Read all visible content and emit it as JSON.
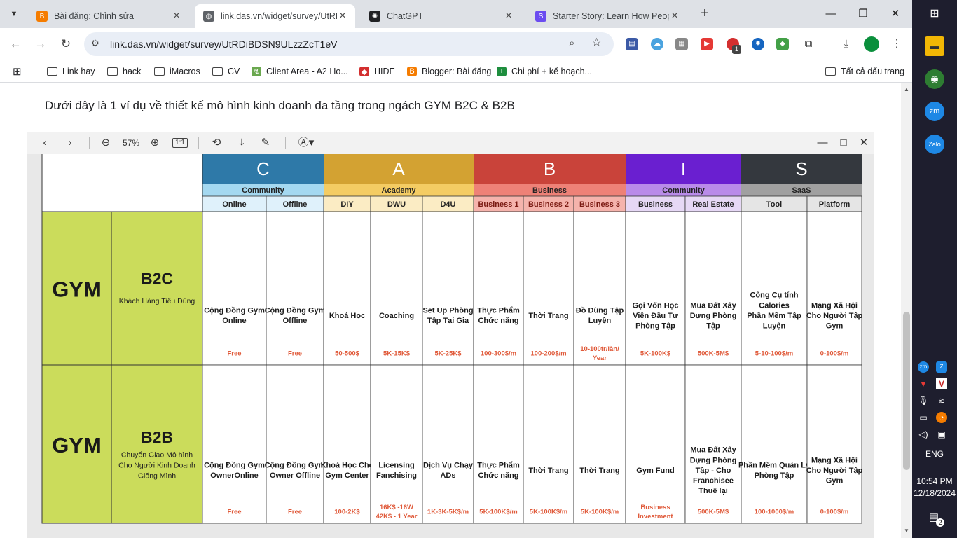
{
  "tabs": [
    {
      "title": "Bài đăng: Chỉnh sửa",
      "icon": "blogger-icon",
      "color": "#f57c00",
      "active": false
    },
    {
      "title": "link.das.vn/widget/survey/UtRD",
      "icon": "globe-icon",
      "color": "#5f6368",
      "active": true
    },
    {
      "title": "ChatGPT",
      "icon": "openai-icon",
      "color": "#202124",
      "active": false
    },
    {
      "title": "Starter Story: Learn How People",
      "icon": "starterstory-icon",
      "color": "#6b4cf0",
      "active": false
    }
  ],
  "address": {
    "url": "link.das.vn/widget/survey/UtRDiBDSN9ULzzZcT1eV"
  },
  "bookmarks": [
    {
      "label": "Link hay",
      "icon": "folder-icon"
    },
    {
      "label": "hack",
      "icon": "folder-icon"
    },
    {
      "label": "iMacros",
      "icon": "folder-icon"
    },
    {
      "label": "CV",
      "icon": "folder-icon"
    },
    {
      "label": "Client Area - A2 Ho...",
      "icon": "a2-icon"
    },
    {
      "label": "HIDE",
      "icon": "hide-icon"
    },
    {
      "label": "Blogger: Bài đăng",
      "icon": "blogger-icon"
    },
    {
      "label": "Chi phí + kế hoạch...",
      "icon": "sheets-icon"
    }
  ],
  "bookmarks_all": "Tất cả dấu trang",
  "page": {
    "intro": "Dưới đây là 1 ví dụ về thiết kế mô hình kinh doanh đa tầng trong ngách GYM B2C & B2B"
  },
  "viewer": {
    "zoom": "57%",
    "one_to_one": "1:1"
  },
  "table": {
    "groups": [
      {
        "letter": "C",
        "name": "Community",
        "head": "#2e79a8",
        "band": "#a4d8f0",
        "sub": "#dff1fb",
        "cols": [
          "Online",
          "Offline"
        ]
      },
      {
        "letter": "A",
        "name": "Academy",
        "head": "#d3a232",
        "band": "#f4cc63",
        "sub": "#fbecc4",
        "cols": [
          "DIY",
          "DWU",
          "D4U"
        ]
      },
      {
        "letter": "B",
        "name": "Business",
        "head": "#c9433a",
        "band": "#ee8177",
        "sub": "#f5b3ac",
        "cols": [
          "Business 1",
          "Business 2",
          "Business 3"
        ]
      },
      {
        "letter": "I",
        "name": "Community",
        "head": "#6a1fd0",
        "band": "#b98be9",
        "sub": "#e6d8f5",
        "cols": [
          "Business",
          "Real Estate"
        ]
      },
      {
        "letter": "S",
        "name": "SaaS",
        "head": "#34383e",
        "band": "#a0a0a0",
        "sub": "#e5e5e5",
        "cols": [
          "Tool",
          "Platform"
        ]
      }
    ],
    "rows": [
      {
        "main": "GYM",
        "tier": "B2C",
        "tier_sub": "Khách Hàng Tiêu Dùng",
        "items": [
          "Cộng Đồng Gym Online",
          "Cộng Đồng Gym Offline",
          "Khoá Học",
          "Coaching",
          "Set Up Phòng Tập Tại Gia",
          "Thực Phẩm Chức năng",
          "Thời Trang",
          "Đồ Dùng Tập Luyện",
          "Gọi Vốn Học Viên Đầu Tư Phòng Tập",
          "Mua Đất Xây Dựng Phòng Tập",
          "Công Cụ tính Calories\n\nPhần Mềm Tập Luyện",
          "Mạng Xã Hội Cho Người Tập Gym"
        ],
        "prices": [
          "Free",
          "Free",
          "50-500$",
          "5K-15K$",
          "5K-25K$",
          "100-300$/m",
          "100-200$/m",
          "10-100tr/lần/ Year",
          "5K-100K$",
          "500K-5M$",
          "5-10-100$/m",
          "0-100$/m"
        ]
      },
      {
        "main": "GYM",
        "tier": "B2B",
        "tier_sub": "Chuyển Giao Mô hình Cho Người Kinh Doanh Giống Mình",
        "items": [
          "Cộng Đồng Gym OwnerOnline",
          "Cộng Đồng Gym Owner Offline",
          "Khoá Học Cho Gym Center",
          "Licensing Fanchising",
          "Dịch Vụ Chạy ADs",
          "Thực Phẩm Chức năng",
          "Thời Trang",
          "Thời Trang",
          "Gym Fund",
          "Mua Đất Xây Dựng Phòng Tập - Cho Franchisee Thuê lại",
          "Phần Mềm Quản Lý Phòng Tập",
          "Mạng Xã Hội Cho Người Tập Gym"
        ],
        "prices": [
          "Free",
          "Free",
          "100-2K$",
          "16K$ -16W 42K$ - 1 Year",
          "1K-3K-5K$/m",
          "5K-100K$/m",
          "5K-100K$/m",
          "5K-100K$/m",
          "Business Investment",
          "500K-5M$",
          "100-1000$/m",
          "0-100$/m"
        ]
      }
    ]
  },
  "system": {
    "language": "ENG",
    "time": "10:54 PM",
    "date": "12/18/2024",
    "notifications": "2",
    "ext_badge": "1"
  },
  "colors": {
    "gym_cell": "#cbdc5b",
    "price": "#e05a3a"
  }
}
